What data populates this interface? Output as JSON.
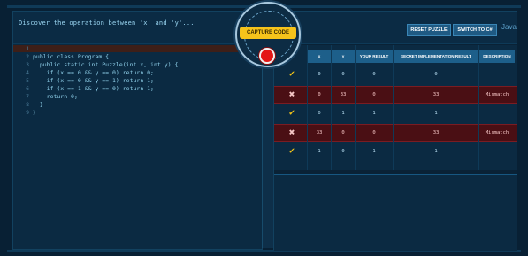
{
  "puzzle": {
    "description": "Discover the operation between 'x' and 'y'..."
  },
  "capture": {
    "label": "CAPTURE CODE"
  },
  "toolbar": {
    "reset_label": "RESET PUZZLE",
    "switch_label": "SWITCH TO C#",
    "language": "Java"
  },
  "code": {
    "lines": [
      {
        "n": "1",
        "text": ""
      },
      {
        "n": "2",
        "text": "public class Program {"
      },
      {
        "n": "3",
        "text": "  public static int Puzzle(int x, int y) {"
      },
      {
        "n": "4",
        "text": "    if (x == 0 && y == 0) return 0;"
      },
      {
        "n": "5",
        "text": "    if (x == 0 && y == 1) return 1;"
      },
      {
        "n": "6",
        "text": "    if (x == 1 && y == 0) return 1;"
      },
      {
        "n": "7",
        "text": "    return 0;"
      },
      {
        "n": "8",
        "text": "  }"
      },
      {
        "n": "9",
        "text": "}"
      }
    ]
  },
  "table": {
    "headers": [
      "",
      "x",
      "y",
      "YOUR RESULT",
      "SECRET IMPLEMENTATION RESULT",
      "DESCRIPTION"
    ],
    "rows": [
      {
        "status": "ok",
        "x": "0",
        "y": "0",
        "yours": "0",
        "secret": "0",
        "desc": ""
      },
      {
        "status": "bad",
        "x": "0",
        "y": "33",
        "yours": "0",
        "secret": "33",
        "desc": "Mismatch"
      },
      {
        "status": "ok",
        "x": "0",
        "y": "1",
        "yours": "1",
        "secret": "1",
        "desc": ""
      },
      {
        "status": "bad",
        "x": "33",
        "y": "0",
        "yours": "0",
        "secret": "33",
        "desc": "Mismatch"
      },
      {
        "status": "ok",
        "x": "1",
        "y": "0",
        "yours": "1",
        "secret": "1",
        "desc": ""
      }
    ]
  },
  "colors": {
    "accent": "#f6c31b",
    "header": "#1d5f8a",
    "mismatch": "#4a0f14",
    "ok_mark": "#f5c518",
    "bad_mark": "#ff2b2b"
  },
  "icons": {
    "ok": "checkmark-icon",
    "bad": "cross-icon",
    "record": "record-icon"
  }
}
